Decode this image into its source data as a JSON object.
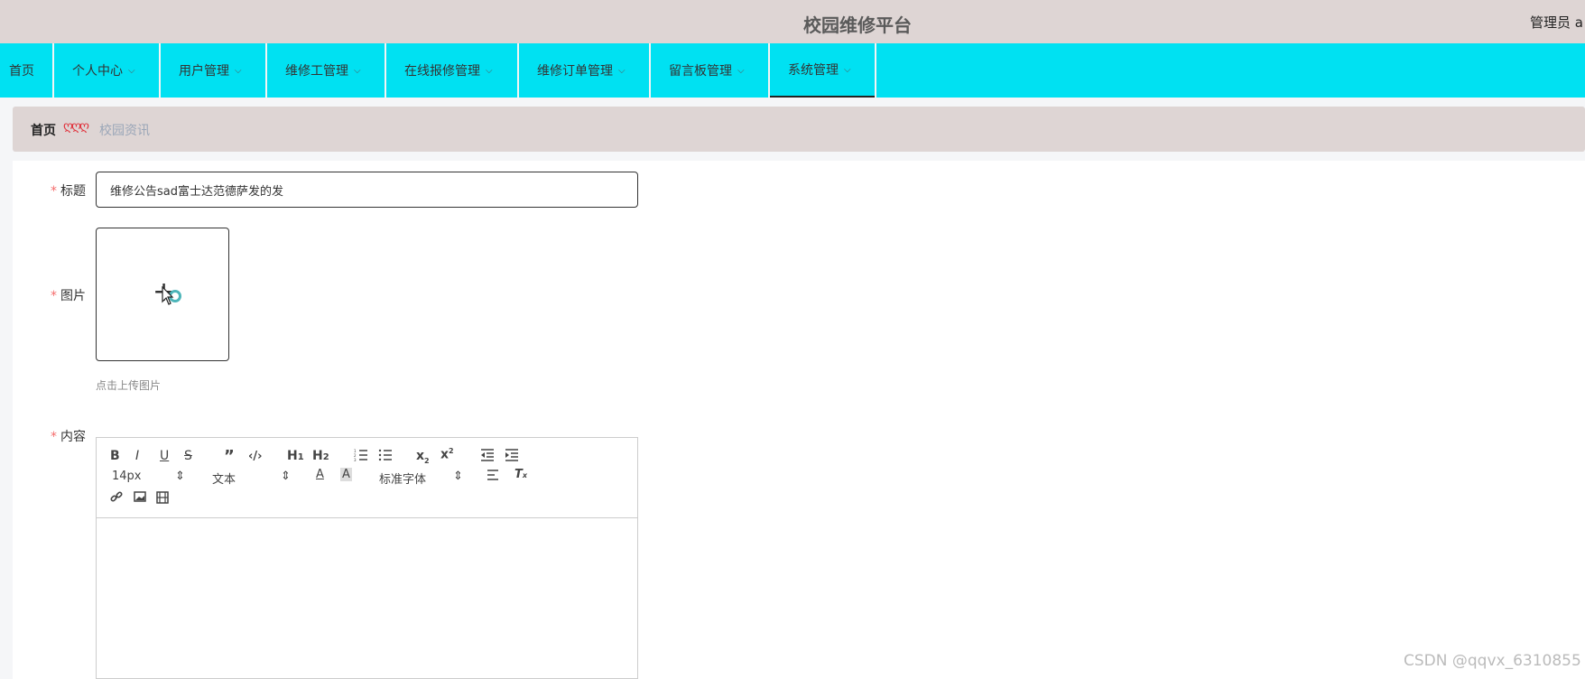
{
  "app": {
    "title": "校园维修平台",
    "user": "管理员 a"
  },
  "nav": {
    "items": [
      {
        "label": "首页"
      },
      {
        "label": "个人中心"
      },
      {
        "label": "用户管理"
      },
      {
        "label": "维修工管理"
      },
      {
        "label": "在线报修管理"
      },
      {
        "label": "维修订单管理"
      },
      {
        "label": "留言板管理"
      },
      {
        "label": "系统管理"
      }
    ],
    "active": "系统管理"
  },
  "breadcrumb": {
    "home": "首页",
    "separator": "ღღღ",
    "current": "校园资讯"
  },
  "form": {
    "title_label": "标题",
    "title_value": "维修公告sad富士达范德萨发的发",
    "image_label": "图片",
    "upload_tip": "点击上传图片",
    "content_label": "内容",
    "required_mark": "*"
  },
  "editor": {
    "font_size": "14px",
    "header_select": "文本",
    "font_family": "标准字体",
    "buttons": [
      "bold-icon",
      "italic-icon",
      "underline-icon",
      "strike-icon",
      "blockquote-icon",
      "code-icon",
      "h1-icon",
      "h2-icon",
      "ordered-list-icon",
      "bullet-list-icon",
      "subscript-icon",
      "superscript-icon",
      "outdent-icon",
      "indent-icon",
      "font-color-icon",
      "background-color-icon",
      "align-icon",
      "clear-format-icon",
      "link-icon",
      "image-icon",
      "video-icon"
    ]
  },
  "watermark": "CSDN @qqvx_6310855",
  "colors": {
    "topbar": "#ded5d4",
    "navbar": "#00e1f2",
    "required": "#f56c6c",
    "breadcrumb_sep": "#e0323c"
  }
}
